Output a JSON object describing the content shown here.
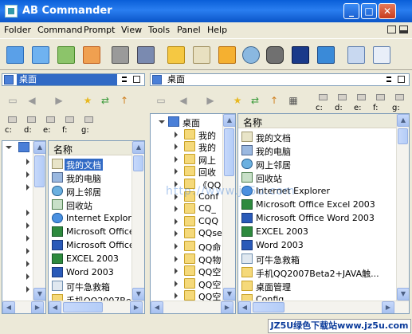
{
  "window": {
    "title": "AB Commander",
    "min": "_",
    "max": "□",
    "close": "✕"
  },
  "menu": [
    "Folder",
    "Command",
    "Prompt",
    "View",
    "Tools",
    "Panel",
    "Help"
  ],
  "toolbar_icons": [
    "copy-icon",
    "copy2-icon",
    "move-icon",
    "delete-icon",
    "disk-icon",
    "network-icon",
    "folder-open-icon",
    "edit-icon",
    "new-folder-icon",
    "find-icon",
    "binoculars-icon",
    "terminal-icon",
    "monitor-icon",
    "list-icon",
    "fullscreen-icon"
  ],
  "left_panel": {
    "path": "桌面",
    "drives": [
      "c:",
      "d:",
      "e:",
      "f:",
      "g:"
    ],
    "column_header": "名称",
    "items": [
      {
        "name": "我的文档",
        "icon": "documents-icon",
        "selected": true
      },
      {
        "name": "我的电脑",
        "icon": "computer-icon"
      },
      {
        "name": "网上邻居",
        "icon": "network-icon"
      },
      {
        "name": "回收站",
        "icon": "recycle-bin-icon"
      },
      {
        "name": "Internet Explore",
        "icon": "ie-icon"
      },
      {
        "name": "Microsoft Office",
        "icon": "excel-icon"
      },
      {
        "name": "Microsoft Office",
        "icon": "word-icon"
      },
      {
        "name": "EXCEL 2003",
        "icon": "excel-icon"
      },
      {
        "name": "Word 2003",
        "icon": "word-icon"
      },
      {
        "name": "可牛急救箱",
        "icon": "tool-icon"
      },
      {
        "name": "手机QQ2007Bet",
        "icon": "folder-icon"
      }
    ]
  },
  "right_panel": {
    "path": "桌面",
    "drives": [
      "c:",
      "d:",
      "e:",
      "f:",
      "g:"
    ],
    "tree": [
      {
        "label": "桌面",
        "level": 0,
        "open": true
      },
      {
        "label": "我的",
        "level": 1
      },
      {
        "label": "我的",
        "level": 1
      },
      {
        "label": "网上",
        "level": 1
      },
      {
        "label": "回收",
        "level": 1
      },
      {
        "label": "《QQ",
        "level": 1
      },
      {
        "label": "Conf",
        "level": 1
      },
      {
        "label": "CQ_",
        "level": 1
      },
      {
        "label": "CQQ",
        "level": 1
      },
      {
        "label": "QQse",
        "level": 1
      },
      {
        "label": "QQ命",
        "level": 1
      },
      {
        "label": "QQ物",
        "level": 1
      },
      {
        "label": "QQ空",
        "level": 1
      },
      {
        "label": "QQ空",
        "level": 1
      },
      {
        "label": "QQ空",
        "level": 1
      }
    ],
    "column_header": "名称",
    "items": [
      {
        "name": "我的文档",
        "icon": "documents-icon"
      },
      {
        "name": "我的电脑",
        "icon": "computer-icon"
      },
      {
        "name": "网上邻居",
        "icon": "network-icon"
      },
      {
        "name": "回收站",
        "icon": "recycle-bin-icon"
      },
      {
        "name": "Internet Explorer",
        "icon": "ie-icon"
      },
      {
        "name": "Microsoft Office Excel 2003",
        "icon": "excel-icon"
      },
      {
        "name": "Microsoft Office Word 2003",
        "icon": "word-icon"
      },
      {
        "name": "EXCEL 2003",
        "icon": "excel-icon"
      },
      {
        "name": "Word 2003",
        "icon": "word-icon"
      },
      {
        "name": "可牛急救箱",
        "icon": "tool-icon"
      },
      {
        "name": "手机QQ2007Beta2+JAVA触...",
        "icon": "folder-icon"
      },
      {
        "name": "桌面管理",
        "icon": "folder-icon"
      },
      {
        "name": "Config",
        "icon": "folder-icon"
      }
    ]
  },
  "watermark_overlay": "http://www.jz5u.com",
  "watermark_badge": "JZ5U绿色下载站www.jz5u.com"
}
